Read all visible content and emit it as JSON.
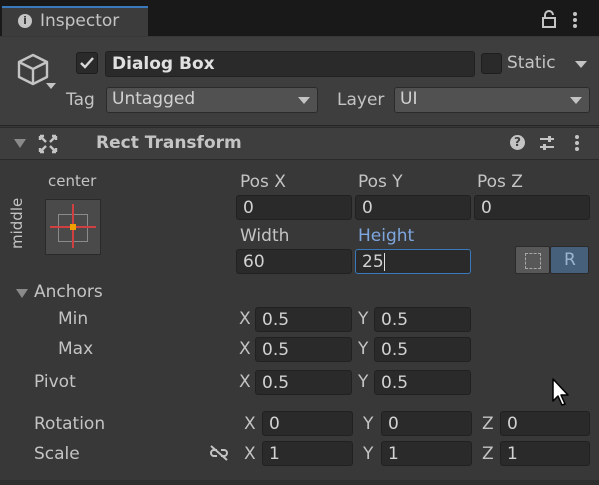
{
  "tab": {
    "title": "Inspector",
    "info_icon": "info-icon",
    "lock_icon": "lock-icon",
    "menu_icon": "kebab-menu-icon"
  },
  "object": {
    "active": true,
    "name": "Dialog Box",
    "static_label": "Static",
    "static_checked": false,
    "tag_label": "Tag",
    "tag_value": "Untagged",
    "layer_label": "Layer",
    "layer_value": "UI",
    "icon": "cube-icon"
  },
  "component": {
    "title": "Rect Transform",
    "icon": "rect-transform-icon",
    "help_icon": "help-icon",
    "presets_icon": "presets-icon",
    "menu_icon": "kebab-menu-icon"
  },
  "anchor_preset": {
    "horizontal": "center",
    "vertical": "middle"
  },
  "position": {
    "pos_x_label": "Pos X",
    "pos_x": "0",
    "pos_y_label": "Pos Y",
    "pos_y": "0",
    "pos_z_label": "Pos Z",
    "pos_z": "0",
    "width_label": "Width",
    "width": "60",
    "height_label": "Height",
    "height": "25"
  },
  "anchors": {
    "label": "Anchors",
    "min_label": "Min",
    "min_x": "0.5",
    "min_y": "0.5",
    "max_label": "Max",
    "max_x": "0.5",
    "max_y": "0.5"
  },
  "pivot": {
    "label": "Pivot",
    "x": "0.5",
    "y": "0.5"
  },
  "rotation": {
    "label": "Rotation",
    "x": "0",
    "y": "0",
    "z": "0"
  },
  "scale": {
    "label": "Scale",
    "x": "1",
    "y": "1",
    "z": "1",
    "link_icon": "unlinked-icon"
  },
  "axes": {
    "x": "X",
    "y": "Y",
    "z": "Z"
  },
  "buttons": {
    "blueprint_icon": "blueprint-mode-icon",
    "raw_edit_label": "R"
  },
  "colors": {
    "highlight": "#7ea7e0",
    "accent_border": "#3a79bb",
    "anchor_dot": "#f0a000",
    "anchor_line": "#d04040"
  }
}
